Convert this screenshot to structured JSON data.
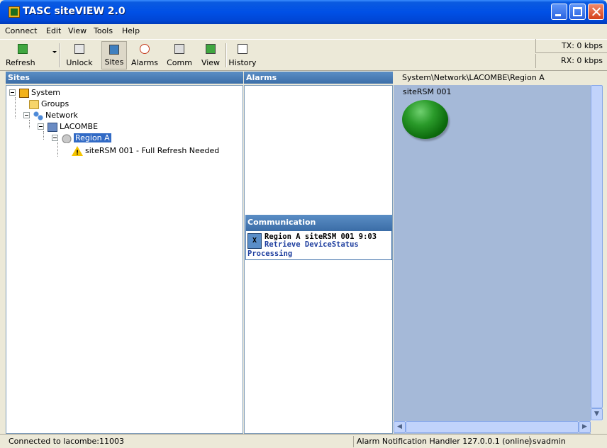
{
  "window": {
    "title": "TASC siteVIEW 2.0"
  },
  "menu": [
    "Connect",
    "Edit",
    "View",
    "Tools",
    "Help"
  ],
  "toolbar": {
    "refresh": "Refresh",
    "unlock": "Unlock",
    "sites": "Sites",
    "alarms": "Alarms",
    "comm": "Comm",
    "view": "View",
    "history": "History",
    "tx": "TX: 0 kbps",
    "rx": "RX: 0 kbps"
  },
  "sites": {
    "header": "Sites",
    "tree": [
      {
        "label": "System",
        "icon": "system-icon"
      },
      {
        "label": "Groups",
        "icon": "folder-icon"
      },
      {
        "label": "Network",
        "icon": "network-icon"
      },
      {
        "label": "LACOMBE",
        "icon": "computer-icon"
      },
      {
        "label": "Region A",
        "icon": "region-icon",
        "selected": true
      },
      {
        "label": "siteRSM 001 - Full Refresh Needed",
        "icon": "warning-icon"
      }
    ]
  },
  "alarms": {
    "header": "Alarms"
  },
  "communication": {
    "header": "Communication",
    "close": "X",
    "line1": "Region A siteRSM 001 9:03",
    "line2": "Retrieve DeviceStatus",
    "line3": "Processing"
  },
  "map": {
    "path": "System\\Network\\LACOMBE\\Region A",
    "device_label": "siteRSM 001",
    "device_status_color": "#1e8f1e"
  },
  "status": {
    "connection": "Connected to lacombe:11003",
    "handler": "Alarm Notification Handler 127.0.0.1 (online)",
    "user": "svadmin"
  }
}
